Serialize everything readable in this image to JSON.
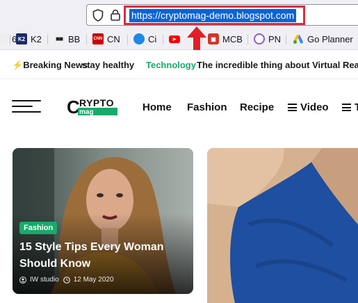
{
  "browser": {
    "url": "https://cryptomag-demo.blogspot.com"
  },
  "bookmarks": [
    {
      "label": "6",
      "icon": "bookmark-favicon",
      "color": "#4a4a4a"
    },
    {
      "label": "K2",
      "icon": "k2-favicon",
      "color": "#1b2a6b"
    },
    {
      "label": "BB",
      "icon": "bb-favicon",
      "color": "#222222"
    },
    {
      "label": "CN",
      "icon": "cnn-favicon",
      "color": "#cc0000"
    },
    {
      "label": "Ci",
      "icon": "ci-favicon",
      "color": "#1e88e5"
    },
    {
      "label": "",
      "icon": "youtube-favicon",
      "color": "#ff0000"
    },
    {
      "label": "MCB",
      "icon": "mcb-favicon",
      "color": "#d0352b"
    },
    {
      "label": "PN",
      "icon": "pn-favicon",
      "color": "#8e5bd1"
    },
    {
      "label": "Go Planner",
      "icon": "google-ads-favicon",
      "color": "#fbbc04"
    }
  ],
  "ticker": {
    "breaking_label": "Breaking News",
    "item1": "stay healthy",
    "category": "Technology",
    "item2": "The incredible thing about Virtual Reality",
    "category_color": "#19a96b"
  },
  "site": {
    "logo_top": "RYPTO",
    "logo_c": "C",
    "logo_bottom": "mag",
    "accent": "#19a96b",
    "nav": [
      {
        "label": "Home"
      },
      {
        "label": "Fashion"
      },
      {
        "label": "Recipe"
      },
      {
        "label": "Video"
      },
      {
        "label": "T"
      }
    ]
  },
  "featured": [
    {
      "badge": "Fashion",
      "title": "15 Style Tips Every Woman Should Know",
      "author": "IW studio",
      "date": "12 May 2020"
    }
  ]
}
